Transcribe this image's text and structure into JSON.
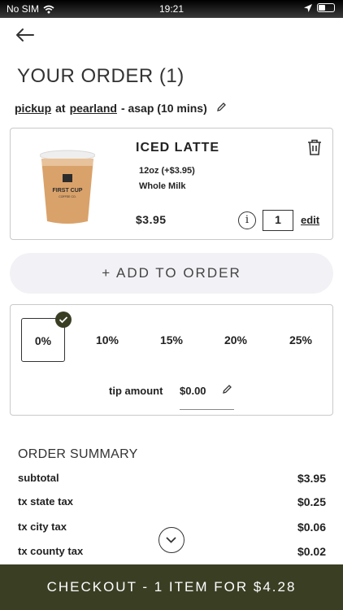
{
  "status": {
    "carrier": "No SIM",
    "time": "19:21"
  },
  "header": {
    "title": "YOUR ORDER (1)"
  },
  "order_meta": {
    "method": "pickup",
    "at": "at",
    "location": "pearland",
    "eta": "- asap (10 mins)"
  },
  "item": {
    "name": "ICED LATTE",
    "size": "12oz (+$3.95)",
    "milk": "Whole Milk",
    "price": "$3.95",
    "quantity": "1",
    "edit_label": "edit",
    "info_glyph": "i",
    "cup_brand": "FIRST CUP",
    "cup_sub": "COFFEE CO."
  },
  "add_button": {
    "label": "+ ADD TO ORDER"
  },
  "tip": {
    "options": [
      "0%",
      "10%",
      "15%",
      "20%",
      "25%"
    ],
    "selected": "0%",
    "amount_label": "tip amount",
    "amount": "$0.00"
  },
  "summary": {
    "title": "ORDER SUMMARY",
    "rows": [
      {
        "label": "subtotal",
        "value": "$3.95"
      },
      {
        "label": "tx state tax",
        "value": "$0.25"
      },
      {
        "label": "tx city tax",
        "value": "$0.06"
      },
      {
        "label": "tx county tax",
        "value": "$0.02"
      }
    ]
  },
  "checkout": {
    "label": "CHECKOUT - 1 ITEM FOR $4.28"
  },
  "colors": {
    "accent": "#3a3f24",
    "button_bg": "#f2f1f5",
    "cup_latte": "#d9a26a"
  },
  "icons": [
    "wifi-icon",
    "location-arrow-icon",
    "battery-icon",
    "back-arrow-icon",
    "pencil-icon",
    "trash-icon",
    "info-icon",
    "check-icon",
    "chevron-down-icon"
  ]
}
